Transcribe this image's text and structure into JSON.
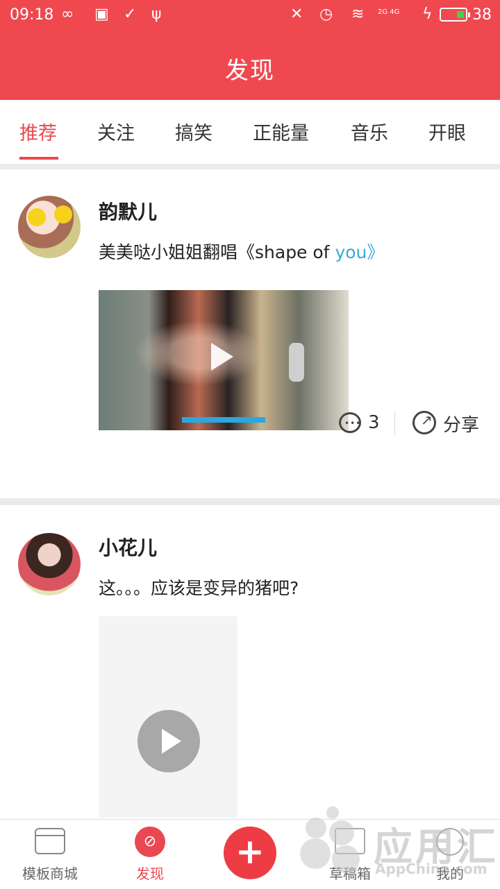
{
  "status_bar": {
    "time": "09:18",
    "battery_level": "38",
    "network_labels": "2G 4G"
  },
  "header": {
    "title": "发现"
  },
  "tabs": [
    {
      "label": "推荐",
      "active": true
    },
    {
      "label": "关注"
    },
    {
      "label": "搞笑"
    },
    {
      "label": "正能量"
    },
    {
      "label": "音乐"
    },
    {
      "label": "开眼"
    }
  ],
  "posts": [
    {
      "username": "韵默儿",
      "text_prefix": "美美哒小姐姐翻唱《shape of ",
      "text_highlight": "you》",
      "comment_count": "3",
      "share_label": "分享"
    },
    {
      "username": "小花儿",
      "text": "这。。。应该是变异的猪吧?"
    }
  ],
  "bottom_nav": {
    "store": "模板商城",
    "discover": "发现",
    "add": "+",
    "drafts": "草稿箱",
    "me": "我的"
  },
  "watermark": {
    "brand": "应用汇",
    "sub": "AppChina.com"
  },
  "colors": {
    "accent": "#f0484f",
    "link": "#35a9d9"
  }
}
